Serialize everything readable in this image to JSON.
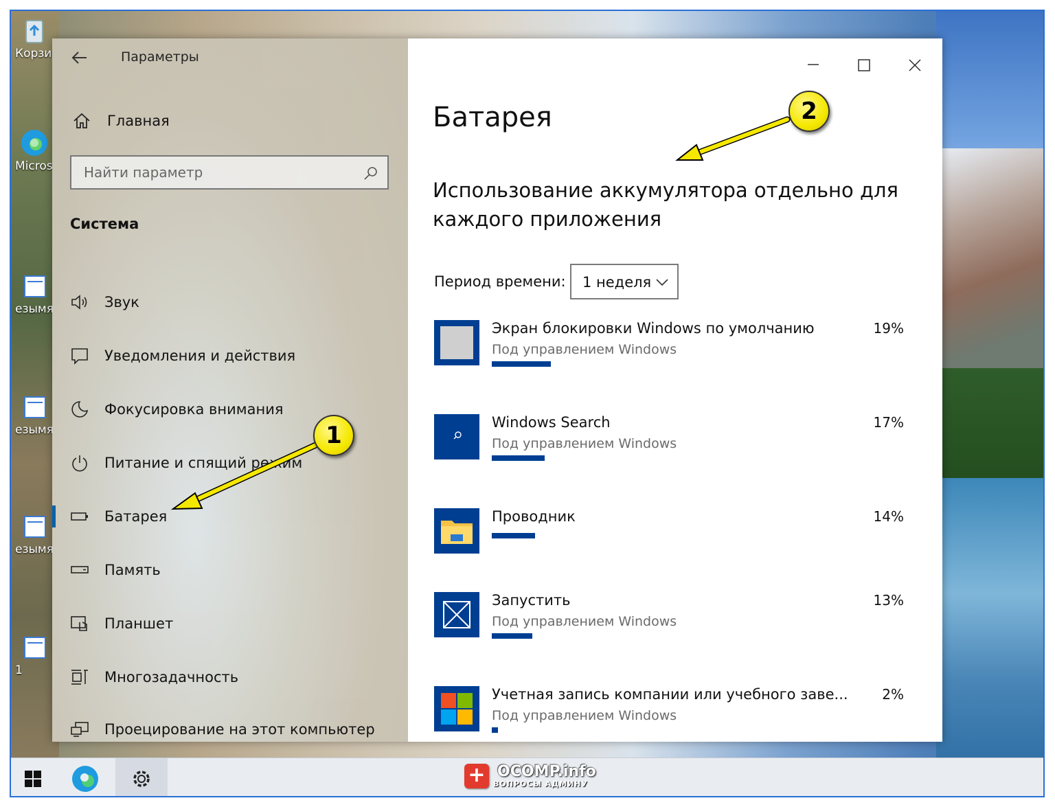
{
  "desktop": {
    "icons": [
      {
        "label": "Корзи"
      },
      {
        "label": "Micros Edg"
      },
      {
        "label": "езымян"
      },
      {
        "label": "езымя"
      },
      {
        "label": "езымя"
      },
      {
        "label": "1"
      }
    ]
  },
  "window": {
    "app_title": "Параметры",
    "home_label": "Главная",
    "search_placeholder": "Найти параметр",
    "section_title": "Система",
    "nav_items": [
      {
        "label": "Звук",
        "icon": "speaker-icon"
      },
      {
        "label": "Уведомления и действия",
        "icon": "notification-icon"
      },
      {
        "label": "Фокусировка внимания",
        "icon": "moon-icon"
      },
      {
        "label": "Питание и спящий режим",
        "icon": "power-icon"
      },
      {
        "label": "Батарея",
        "icon": "battery-icon",
        "selected": true
      },
      {
        "label": "Память",
        "icon": "storage-icon"
      },
      {
        "label": "Планшет",
        "icon": "tablet-icon"
      },
      {
        "label": "Многозадачность",
        "icon": "multitasking-icon"
      },
      {
        "label": "Проецирование на этот компьютер",
        "icon": "projecting-icon"
      }
    ],
    "page_title": "Батарея",
    "subheading": "Использование аккумулятора отдельно для каждого приложения",
    "period_label": "Период времени:",
    "period_value": "1 неделя",
    "apps": [
      {
        "name": "Экран блокировки Windows по умолчанию",
        "sub": "Под управлением Windows",
        "percent": "19%",
        "usage": 0.19
      },
      {
        "name": "Windows Search",
        "sub": "Под управлением Windows",
        "percent": "17%",
        "usage": 0.17
      },
      {
        "name": "Проводник",
        "sub": "",
        "percent": "14%",
        "usage": 0.14
      },
      {
        "name": "Запустить",
        "sub": "Под управлением Windows",
        "percent": "13%",
        "usage": 0.13
      },
      {
        "name": "Учетная запись компании или учебного заве...",
        "sub": "Под управлением Windows",
        "percent": "2%",
        "usage": 0.02
      }
    ]
  },
  "annotations": {
    "badge1": "1",
    "badge2": "2"
  },
  "watermark": {
    "title": "OCOMP.info",
    "subtitle": "ВОПРОСЫ АДМИНУ"
  },
  "colors": {
    "accent": "#0063b1",
    "bar": "#003e92",
    "arrow": "#f5e800"
  }
}
